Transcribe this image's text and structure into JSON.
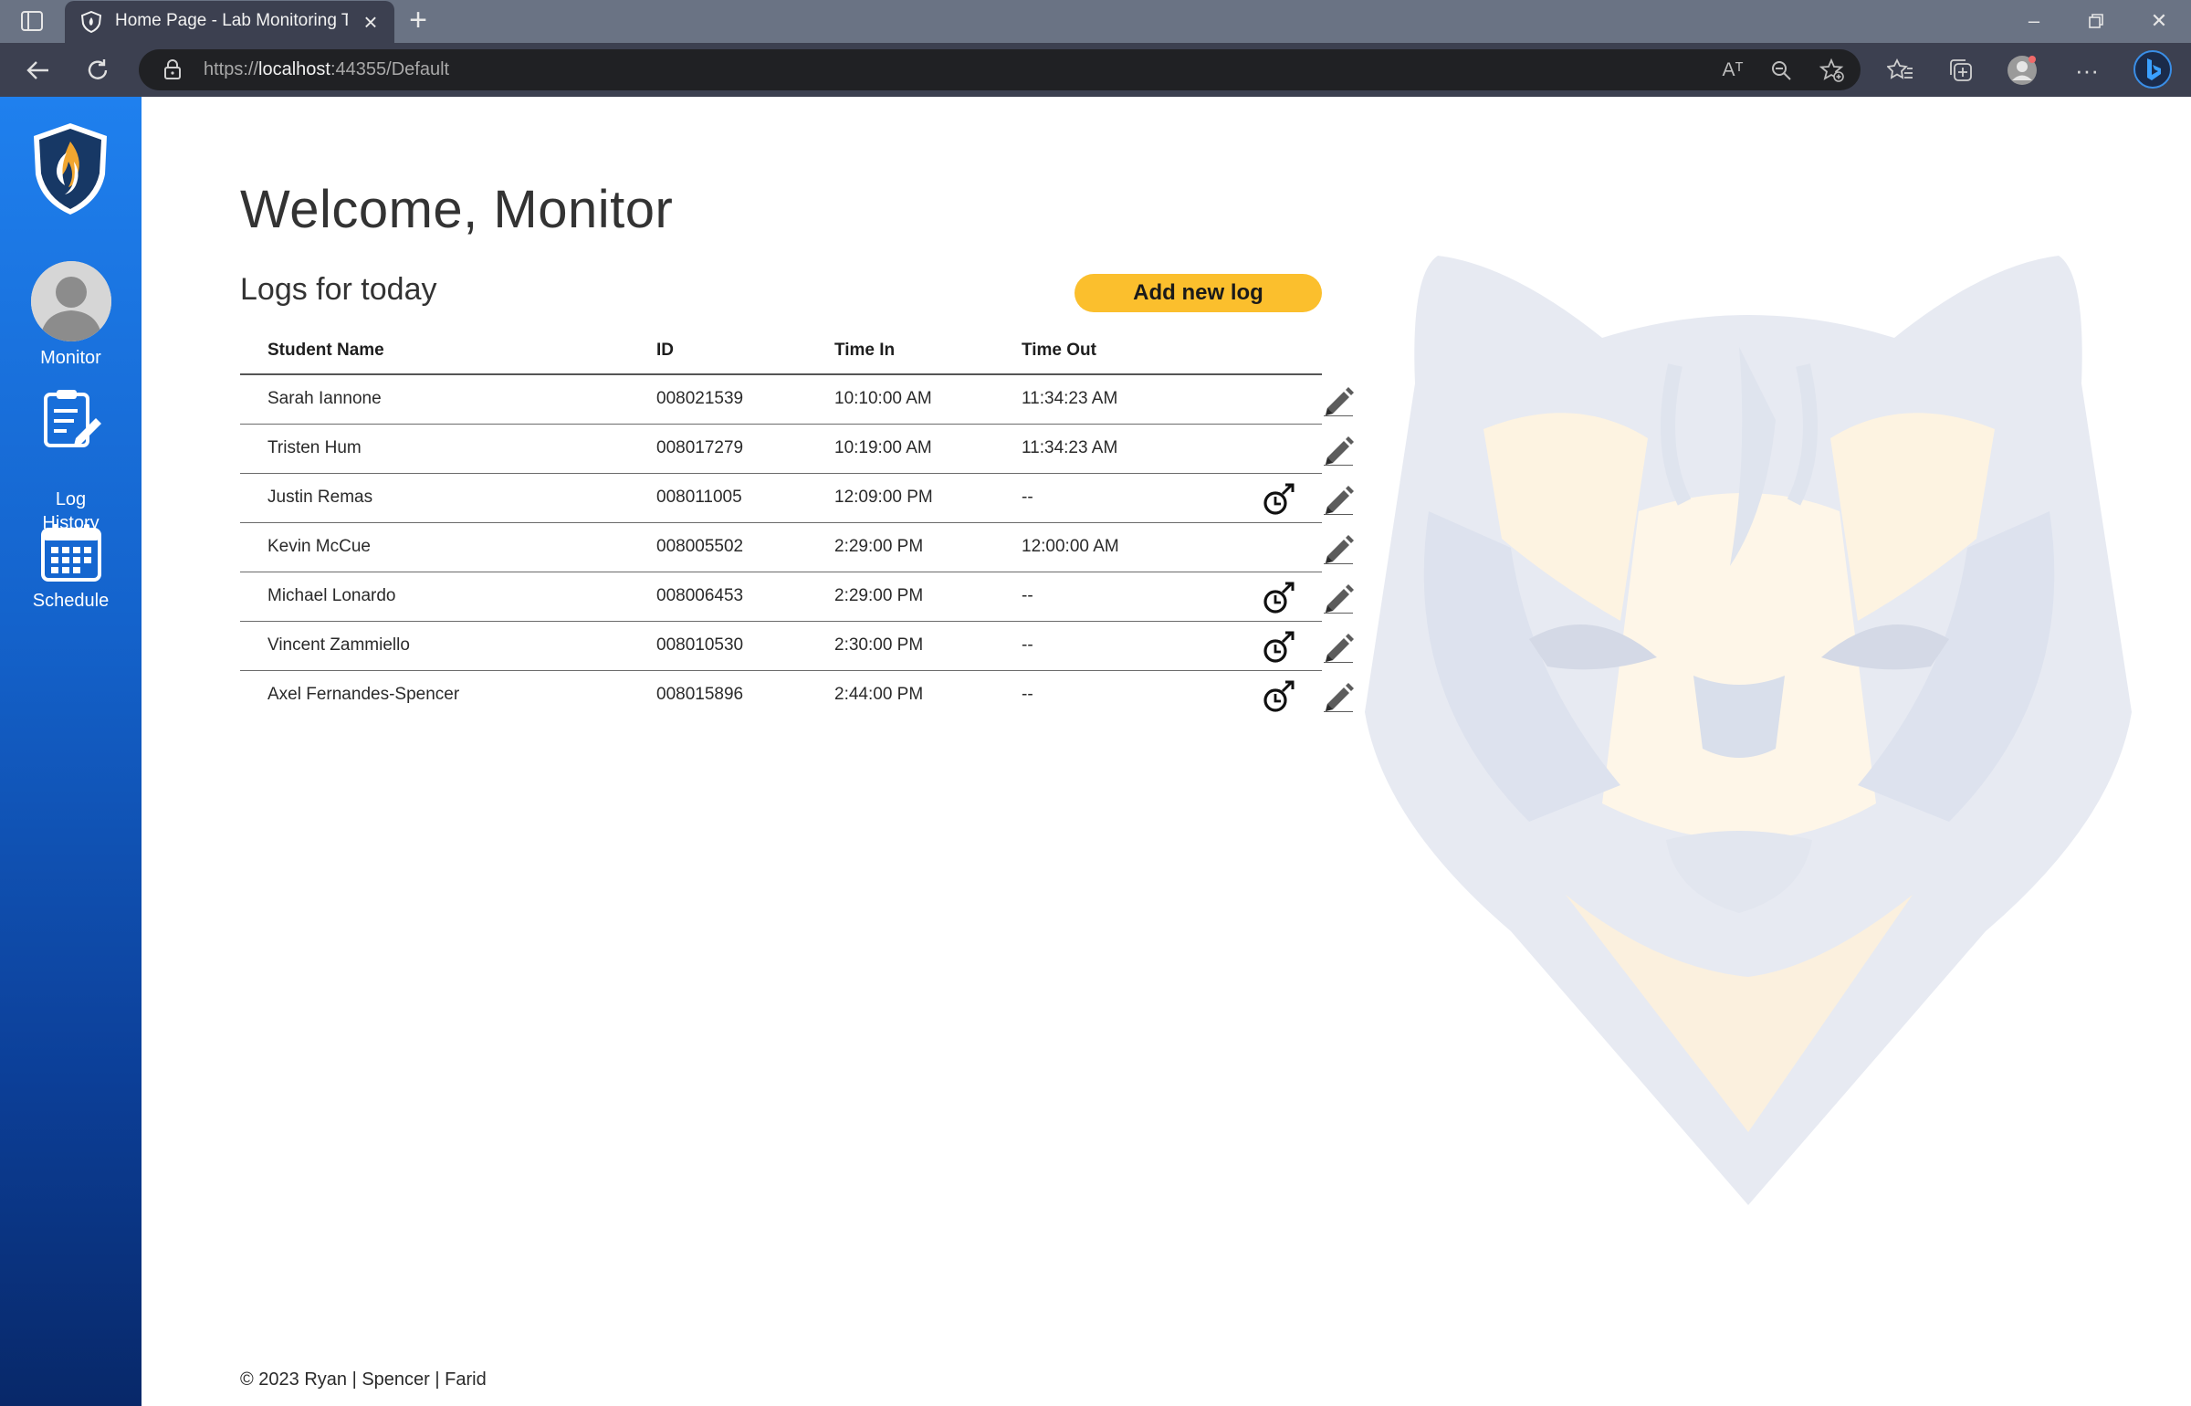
{
  "browser": {
    "tab_title": "Home Page - Lab Monitoring To",
    "url_scheme": "https://",
    "url_host": "localhost",
    "url_rest": ":44355/Default",
    "reader_label": "Aᵀ"
  },
  "sidebar": {
    "items": [
      {
        "label": "Monitor",
        "icon": "user-avatar-icon"
      },
      {
        "label": "Log\nHistory",
        "icon": "clipboard-edit-icon"
      },
      {
        "label": "Schedule",
        "icon": "calendar-icon"
      }
    ]
  },
  "main": {
    "title": "Welcome, Monitor",
    "logs_heading": "Logs for today",
    "add_button_label": "Add new log",
    "table": {
      "headers": [
        "Student Name",
        "ID",
        "Time In",
        "Time Out"
      ],
      "rows": [
        {
          "name": "Sarah Iannone",
          "id": "008021539",
          "time_in": "10:10:00 AM",
          "time_out": "11:34:23 AM",
          "has_clockout": false
        },
        {
          "name": "Tristen Hum",
          "id": "008017279",
          "time_in": "10:19:00 AM",
          "time_out": "11:34:23 AM",
          "has_clockout": false
        },
        {
          "name": "Justin Remas",
          "id": "008011005",
          "time_in": "12:09:00 PM",
          "time_out": "--",
          "has_clockout": true
        },
        {
          "name": "Kevin McCue",
          "id": "008005502",
          "time_in": "2:29:00 PM",
          "time_out": "12:00:00 AM",
          "has_clockout": false
        },
        {
          "name": "Michael Lonardo",
          "id": "008006453",
          "time_in": "2:29:00 PM",
          "time_out": "--",
          "has_clockout": true
        },
        {
          "name": "Vincent Zammiello",
          "id": "008010530",
          "time_in": "2:30:00 PM",
          "time_out": "--",
          "has_clockout": true
        },
        {
          "name": "Axel Fernandes-Spencer",
          "id": "008015896",
          "time_in": "2:44:00 PM",
          "time_out": "--",
          "has_clockout": true
        }
      ]
    }
  },
  "footer": {
    "text": "© 2023 Ryan | Spencer | Farid"
  },
  "colors": {
    "sidebar_top": "#1f80ee",
    "sidebar_bottom": "#082869",
    "accent_button": "#fbbf2d",
    "browser_titlebar": "#6a7384",
    "browser_toolbar": "#3c4050"
  }
}
